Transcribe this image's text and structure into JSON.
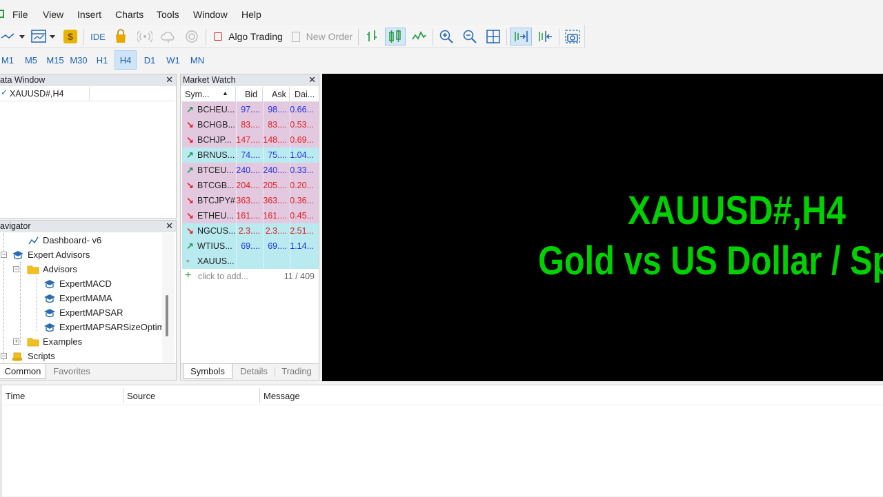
{
  "menu": [
    "File",
    "View",
    "Insert",
    "Charts",
    "Tools",
    "Window",
    "Help"
  ],
  "toolbar": {
    "ide_label": "IDE",
    "algo_trading_label": "Algo Trading",
    "new_order_label": "New Order"
  },
  "periods": [
    "M1",
    "M5",
    "M15",
    "M30",
    "H1",
    "H4",
    "D1",
    "W1",
    "MN"
  ],
  "active_period": "H4",
  "data_window": {
    "title": "Data Window",
    "symbol": "XAUUSD#,H4"
  },
  "navigator": {
    "title": "Navigator",
    "items": [
      {
        "label": "Dashboard- v6"
      },
      {
        "label": "Expert Advisors"
      },
      {
        "label": "Advisors"
      },
      {
        "label": "ExpertMACD"
      },
      {
        "label": "ExpertMAMA"
      },
      {
        "label": "ExpertMAPSAR"
      },
      {
        "label": "ExpertMAPSARSizeOptim"
      },
      {
        "label": "Examples"
      },
      {
        "label": "Scripts"
      }
    ],
    "tabs": [
      "Common",
      "Favorites"
    ]
  },
  "market_watch": {
    "title": "Market Watch",
    "columns": [
      "Sym...",
      "Bid",
      "Ask",
      "Dai..."
    ],
    "rows": [
      {
        "symbol": "BCHEU...",
        "bid": "97....",
        "ask": "98....",
        "daily": "0.66...",
        "dir": "up",
        "bg": "#e3c9e0",
        "color": "#2233dd"
      },
      {
        "symbol": "BCHGB...",
        "bid": "83....",
        "ask": "83....",
        "daily": "0.53...",
        "dir": "down",
        "bg": "#e3c9e0",
        "color": "#e02020"
      },
      {
        "symbol": "BCHJP...",
        "bid": "147....",
        "ask": "148....",
        "daily": "0.69...",
        "dir": "down",
        "bg": "#e3c9e0",
        "color": "#e02020"
      },
      {
        "symbol": "BRNUS...",
        "bid": "74....",
        "ask": "75....",
        "daily": "1.04...",
        "dir": "up",
        "bg": "#b8eaf0",
        "color": "#2233dd"
      },
      {
        "symbol": "BTCEU...",
        "bid": "240....",
        "ask": "240....",
        "daily": "0.33...",
        "dir": "up",
        "bg": "#e3c9e0",
        "color": "#2233dd"
      },
      {
        "symbol": "BTCGB...",
        "bid": "204....",
        "ask": "205....",
        "daily": "0.20...",
        "dir": "down",
        "bg": "#e3c9e0",
        "color": "#e02020"
      },
      {
        "symbol": "BTCJPY#",
        "bid": "363....",
        "ask": "363....",
        "daily": "0.36...",
        "dir": "down",
        "bg": "#e3c9e0",
        "color": "#e02020"
      },
      {
        "symbol": "ETHEU...",
        "bid": "161....",
        "ask": "161....",
        "daily": "0.45...",
        "dir": "down",
        "bg": "#e3c9e0",
        "color": "#e02020"
      },
      {
        "symbol": "NGCUS...",
        "bid": "2.3....",
        "ask": "2.3....",
        "daily": "2.51...",
        "dir": "down",
        "bg": "#b8eaf0",
        "color": "#e02020"
      },
      {
        "symbol": "WTIUS...",
        "bid": "69....",
        "ask": "69....",
        "daily": "1.14...",
        "dir": "up",
        "bg": "#b8eaf0",
        "color": "#2233dd"
      },
      {
        "symbol": "XAUUS...",
        "bid": "",
        "ask": "",
        "daily": "",
        "dir": "none",
        "bg": "#b8eaf0",
        "color": "#2233dd"
      }
    ],
    "add_label": "click to add...",
    "count": "11 / 409",
    "tabs": [
      "Symbols",
      "Details",
      "Trading"
    ]
  },
  "chart": {
    "symbol_line": "XAUUSD#,H4",
    "desc_line": "Gold vs US Dollar / Spot",
    "text_color": "#00d000"
  },
  "journal": {
    "columns": [
      "Time",
      "Source",
      "Message"
    ]
  }
}
